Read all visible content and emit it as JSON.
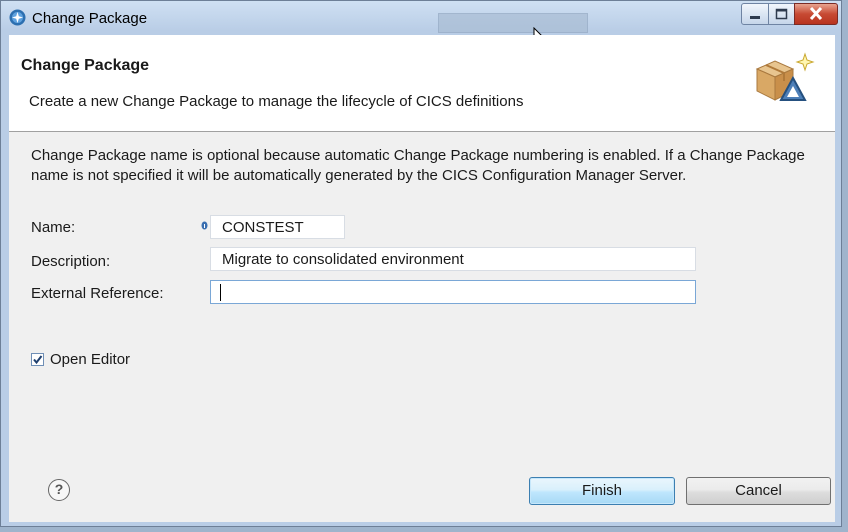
{
  "window": {
    "title": "Change Package",
    "title_icon": "gear-star-icon",
    "controls": [
      "minimize-icon",
      "maximize-icon",
      "close-icon"
    ]
  },
  "banner": {
    "title": "Change Package",
    "description": "Create a new Change Package to manage the lifecycle of CICS definitions",
    "icon": "package-icon"
  },
  "intro_text": "Change Package name is optional because automatic Change Package numbering is enabled. If a Change Package name is not specified it will be automatically generated by the CICS Configuration Manager Server.",
  "form": {
    "name": {
      "label": "Name:",
      "value": "CONSTEST"
    },
    "description": {
      "label": "Description:",
      "value": "Migrate to consolidated environment"
    },
    "external_reference": {
      "label": "External Reference:",
      "value": ""
    },
    "open_editor": {
      "label": "Open Editor",
      "checked": true
    }
  },
  "buttons": {
    "help": "?",
    "finish": "Finish",
    "cancel": "Cancel"
  },
  "colors": {
    "title_bar": "#b9cde6",
    "close_button": "#c74a33",
    "default_button": "#bee6fd"
  }
}
